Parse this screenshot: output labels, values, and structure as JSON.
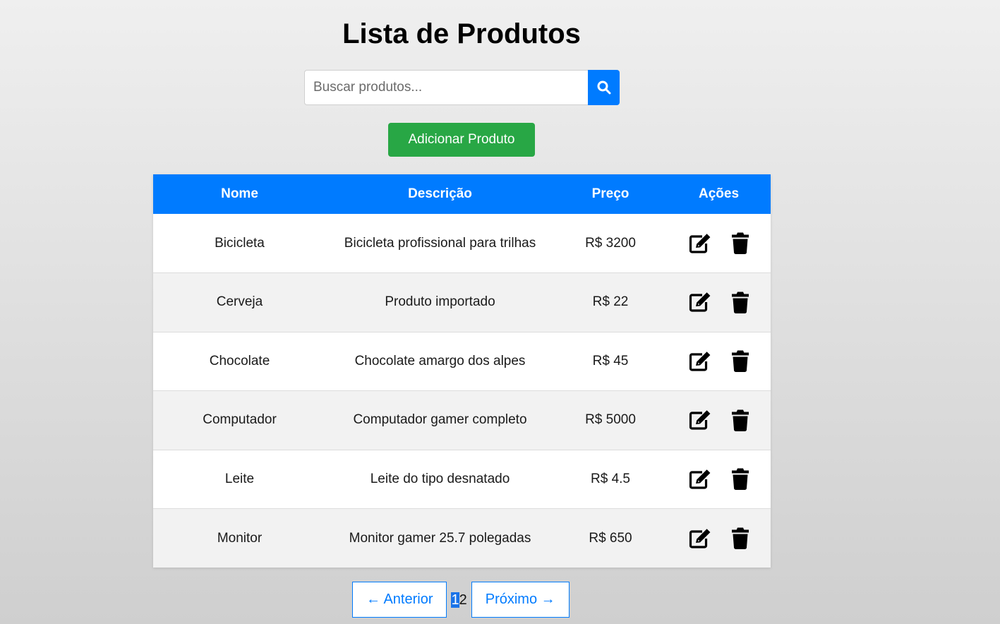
{
  "page": {
    "title": "Lista de Produtos"
  },
  "search": {
    "placeholder": "Buscar produtos...",
    "value": "",
    "icon": "search-icon"
  },
  "toolbar": {
    "add_label": "Adicionar Produto"
  },
  "colors": {
    "primary": "#007bff",
    "success": "#28a745"
  },
  "table": {
    "headers": {
      "name": "Nome",
      "description": "Descrição",
      "price": "Preço",
      "actions": "Ações"
    },
    "rows": [
      {
        "name": "Bicicleta",
        "description": "Bicicleta profissional para trilhas",
        "price": "R$ 3200"
      },
      {
        "name": "Cerveja",
        "description": "Produto importado",
        "price": "R$ 22"
      },
      {
        "name": "Chocolate",
        "description": "Chocolate amargo dos alpes",
        "price": "R$ 45"
      },
      {
        "name": "Computador",
        "description": "Computador gamer completo",
        "price": "R$ 5000"
      },
      {
        "name": "Leite",
        "description": "Leite do tipo desnatado",
        "price": "R$ 4.5"
      },
      {
        "name": "Monitor",
        "description": "Monitor gamer 25.7 polegadas",
        "price": "R$ 650"
      }
    ]
  },
  "pagination": {
    "prev_label": "← Anterior",
    "next_label": "Próximo →",
    "pages": [
      "1",
      "2"
    ],
    "current_page": "1"
  }
}
